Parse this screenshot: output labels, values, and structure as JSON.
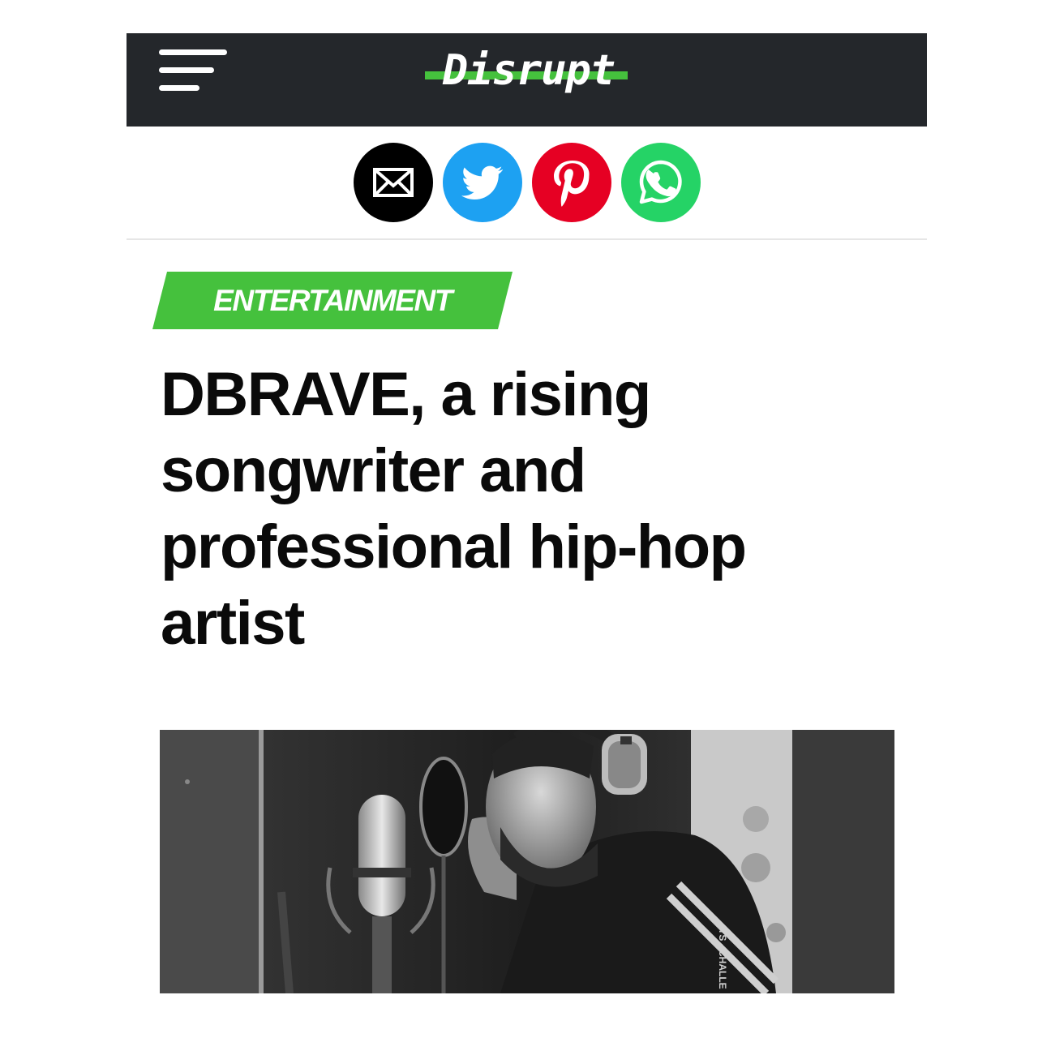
{
  "header": {
    "logo_text": "Disrupt",
    "menu_icon": "hamburger-menu-icon",
    "background": "#24272b",
    "accent": "#45c13d"
  },
  "share": {
    "buttons": [
      {
        "name": "email",
        "icon": "email-icon",
        "color": "#000000"
      },
      {
        "name": "twitter",
        "icon": "twitter-icon",
        "color": "#1da1f2"
      },
      {
        "name": "pinterest",
        "icon": "pinterest-icon",
        "color": "#e60023"
      },
      {
        "name": "whatsapp",
        "icon": "whatsapp-icon",
        "color": "#25d366"
      }
    ]
  },
  "article": {
    "category": "ENTERTAINMENT",
    "category_color": "#45c13d",
    "headline": "DBRAVE, a rising songwriter and professional hip-hop artist"
  },
  "hero_image": {
    "jacket_text": "TS - CHALLE"
  }
}
